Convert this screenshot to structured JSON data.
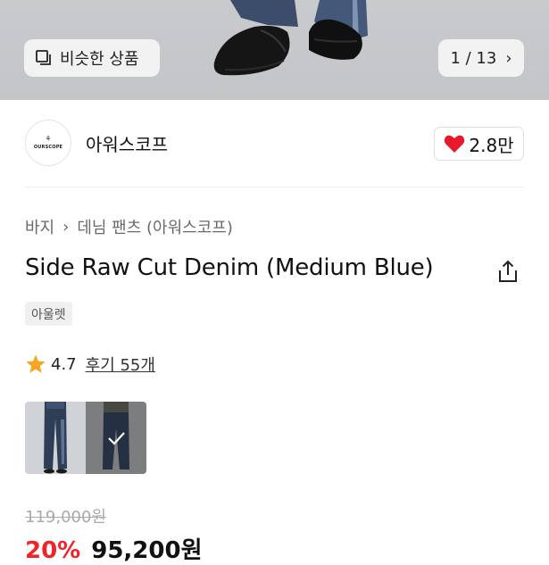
{
  "hero": {
    "similar_button_label": "비슷한 상품",
    "image_counter": "1 / 13"
  },
  "brand": {
    "logo_text": "OURSCOPE",
    "name": "아워스코프",
    "likes": "2.8만"
  },
  "breadcrumb": {
    "items": [
      "바지",
      "데님 팬츠 (아워스코프)"
    ]
  },
  "product": {
    "title": "Side Raw Cut Denim (Medium Blue)",
    "badge": "아울렛",
    "rating": "4.7",
    "reviews_link": "후기 55개",
    "original_price": "119,000원",
    "discount": "20%",
    "sale_price": "95,200원"
  },
  "colors": {
    "accent_red": "#f0232a",
    "heart_red": "#e8192c",
    "star_orange": "#f5a623"
  }
}
